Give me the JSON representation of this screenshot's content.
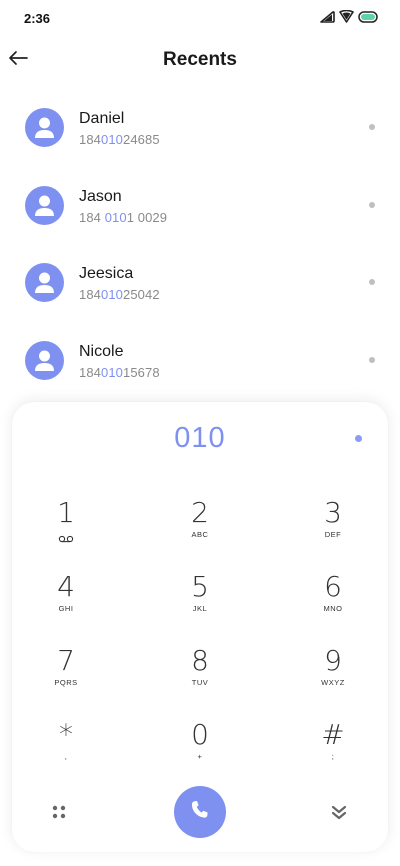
{
  "status_bar": {
    "time": "2:36"
  },
  "header": {
    "title": "Recents"
  },
  "contacts": [
    {
      "name": "Daniel",
      "number_prefix": "184",
      "number_match": "010",
      "number_suffix": "24685"
    },
    {
      "name": "Jason",
      "number_prefix": "184 ",
      "number_match": "010",
      "number_suffix": "1 0029"
    },
    {
      "name": "Jeesica",
      "number_prefix": "184",
      "number_match": "010",
      "number_suffix": "25042"
    },
    {
      "name": "Nicole",
      "number_prefix": "184",
      "number_match": "010",
      "number_suffix": "15678"
    }
  ],
  "dialpad": {
    "entered_number": "010",
    "keys": [
      {
        "digit": "1",
        "letters": ""
      },
      {
        "digit": "2",
        "letters": "ABC"
      },
      {
        "digit": "3",
        "letters": "DEF"
      },
      {
        "digit": "4",
        "letters": "GHI"
      },
      {
        "digit": "5",
        "letters": "JKL"
      },
      {
        "digit": "6",
        "letters": "MNO"
      },
      {
        "digit": "7",
        "letters": "PQRS"
      },
      {
        "digit": "8",
        "letters": "TUV"
      },
      {
        "digit": "9",
        "letters": "WXYZ"
      },
      {
        "digit": "*",
        "letters": ","
      },
      {
        "digit": "0",
        "letters": "+"
      },
      {
        "digit": "#",
        "letters": ";"
      }
    ]
  },
  "icons": {
    "back": "arrow-left-icon",
    "voicemail": "voicemail-icon",
    "grid": "grid-dots-icon",
    "call": "phone-icon",
    "collapse": "chevron-double-down-icon"
  },
  "colors": {
    "accent": "#7f91f0",
    "text": "#1a1a1a",
    "muted": "#8a8a8a"
  }
}
